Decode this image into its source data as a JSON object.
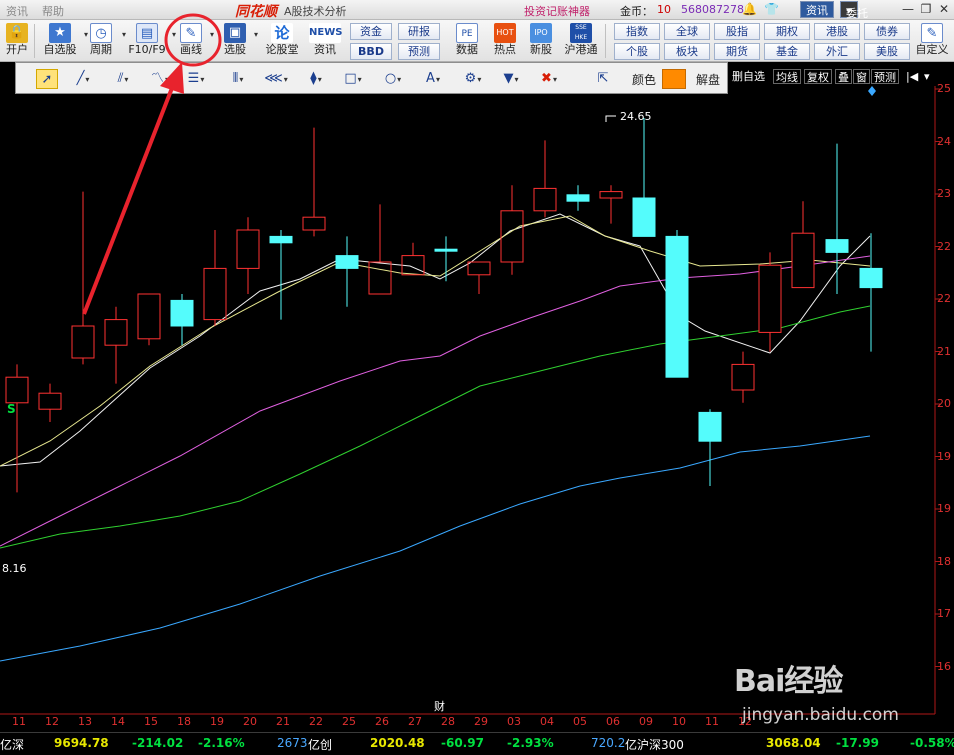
{
  "titlebar": {
    "menu": [
      "资讯",
      "帮助"
    ],
    "app_logo": "同花顺",
    "window_title": "A股技术分析",
    "promo": "投资记账神器",
    "coin_label": "金币：",
    "coin_value": "10",
    "account_no": "568087278",
    "news_button": "资讯",
    "entrust_button": "委托"
  },
  "toolbar": {
    "tools": [
      {
        "label": "开户",
        "icon": "lock-icon",
        "color": "#e0a000"
      },
      {
        "label": "自选股",
        "icon": "star-icon",
        "color": "#3f78d0"
      },
      {
        "label": "周期",
        "icon": "clock-icon",
        "color": "#4a7bd0"
      },
      {
        "label": "F10/F9",
        "icon": "f10-icon",
        "color": "#3a6cc0"
      },
      {
        "label": "画线",
        "icon": "pencil-icon",
        "color": "#3a6cc0"
      },
      {
        "label": "选股",
        "icon": "monitor-icon",
        "color": "#2f5fb0"
      },
      {
        "label": "论股堂",
        "icon": "forum-icon",
        "color": "#1d6ad6"
      },
      {
        "label": "资讯",
        "icon": "news-icon",
        "color": "#1f4fa8"
      }
    ],
    "news_text": "NEWS",
    "forum_glyph": "论",
    "sq_buttons": [
      "资金",
      "研报",
      "BBD",
      "预测"
    ],
    "icon_tools": [
      {
        "label": "数据",
        "badge": "PE"
      },
      {
        "label": "热点",
        "badge": "HOT"
      },
      {
        "label": "新股",
        "badge": "IPO"
      },
      {
        "label": "沪港通",
        "badge": "SSE HKE"
      }
    ],
    "right_grid": [
      "指数",
      "全球",
      "股指",
      "期权",
      "港股",
      "债券",
      "个股",
      "板块",
      "期货",
      "基金",
      "外汇",
      "美股"
    ],
    "customize_label": "自定义"
  },
  "draw_palette": {
    "tools": [
      "select-arrow-icon",
      "line-icon",
      "parallel-line-icon",
      "polyline-icon",
      "text-box-icon",
      "bar-lines-icon",
      "fan-line-icon",
      "fib-icon",
      "rectangle-icon",
      "ellipse-icon",
      "text-a-icon",
      "settings-gear-icon",
      "stamp-icon",
      "delete-x-icon",
      "export-icon"
    ],
    "color_label": "颜色",
    "color_value": "#ff8a00",
    "unlock_label": "解盘"
  },
  "chart_options": [
    "删自选",
    "均线",
    "复权",
    "叠",
    "窗",
    "预测"
  ],
  "chart_data": {
    "type": "candlestick",
    "title": "",
    "price_axis": [
      "25",
      "24",
      "23",
      "22",
      "22",
      "21",
      "20",
      "19",
      "19",
      "18",
      "17",
      "16"
    ],
    "date_axis": [
      "11",
      "12",
      "13",
      "14",
      "15",
      "18",
      "19",
      "20",
      "21",
      "22",
      "25",
      "26",
      "27",
      "28",
      "29",
      "03",
      "04",
      "05",
      "06",
      "09",
      "10",
      "11",
      "12"
    ],
    "high_label": "24.65",
    "low_label": "8.16",
    "signal": "S",
    "fin_marker": "财",
    "candles": [
      {
        "o": 20.2,
        "c": 20.6,
        "h": 20.8,
        "l": 18.8,
        "up": true
      },
      {
        "o": 20.1,
        "c": 20.35,
        "h": 20.5,
        "l": 19.9,
        "up": true
      },
      {
        "o": 20.9,
        "c": 21.4,
        "h": 23.5,
        "l": 20.8,
        "up": true
      },
      {
        "o": 21.1,
        "c": 21.5,
        "h": 21.7,
        "l": 20.5,
        "up": true
      },
      {
        "o": 21.2,
        "c": 21.9,
        "h": 21.9,
        "l": 21.1,
        "up": true
      },
      {
        "o": 21.8,
        "c": 21.4,
        "h": 21.9,
        "l": 21.1,
        "up": false
      },
      {
        "o": 21.5,
        "c": 22.3,
        "h": 22.9,
        "l": 21.4,
        "up": true
      },
      {
        "o": 22.3,
        "c": 22.9,
        "h": 23.1,
        "l": 21.9,
        "up": true
      },
      {
        "o": 22.7,
        "c": 22.8,
        "h": 22.9,
        "l": 21.5,
        "up": false
      },
      {
        "o": 23.1,
        "c": 22.9,
        "h": 24.5,
        "l": 22.8,
        "up": true
      },
      {
        "o": 22.5,
        "c": 22.3,
        "h": 22.8,
        "l": 21.7,
        "up": false
      },
      {
        "o": 21.9,
        "c": 22.4,
        "h": 23.3,
        "l": 21.9,
        "up": true
      },
      {
        "o": 22.2,
        "c": 22.5,
        "h": 22.7,
        "l": 22.2,
        "up": true
      },
      {
        "o": 22.6,
        "c": 22.6,
        "h": 22.8,
        "l": 22.1,
        "up": false
      },
      {
        "o": 22.2,
        "c": 22.4,
        "h": 22.4,
        "l": 21.9,
        "up": true
      },
      {
        "o": 22.4,
        "c": 23.2,
        "h": 23.6,
        "l": 22.2,
        "up": true
      },
      {
        "o": 23.2,
        "c": 23.55,
        "h": 24.3,
        "l": 23.1,
        "up": true
      },
      {
        "o": 23.45,
        "c": 23.35,
        "h": 23.6,
        "l": 23.2,
        "up": false
      },
      {
        "o": 23.4,
        "c": 23.5,
        "h": 23.6,
        "l": 23.0,
        "up": true
      },
      {
        "o": 23.4,
        "c": 22.8,
        "h": 24.65,
        "l": 22.8,
        "up": false
      },
      {
        "o": 22.8,
        "c": 20.6,
        "h": 22.9,
        "l": 20.6,
        "up": false
      },
      {
        "o": 20.05,
        "c": 19.6,
        "h": 20.1,
        "l": 18.9,
        "up": false
      },
      {
        "o": 20.4,
        "c": 20.8,
        "h": 21.0,
        "l": 20.2,
        "up": true
      }
    ]
  },
  "statusbar": {
    "seg1": "亿深",
    "seg1_value": "9694.78",
    "seg1_change": "-214.02",
    "seg1_pct": "-2.16%",
    "seg2_amount": "2673",
    "seg2_label": "亿创",
    "seg2_value": "2020.48",
    "seg2_change": "-60.97",
    "seg2_pct": "-2.93%",
    "seg3_amount": "720.2",
    "seg3_label": "亿沪深300",
    "seg3_value": "3068.04",
    "seg3_change": "-17.99",
    "seg3_pct": "-0.58%"
  },
  "watermark": {
    "logo": "Bai经验",
    "url": "jingyan.baidu.com"
  }
}
